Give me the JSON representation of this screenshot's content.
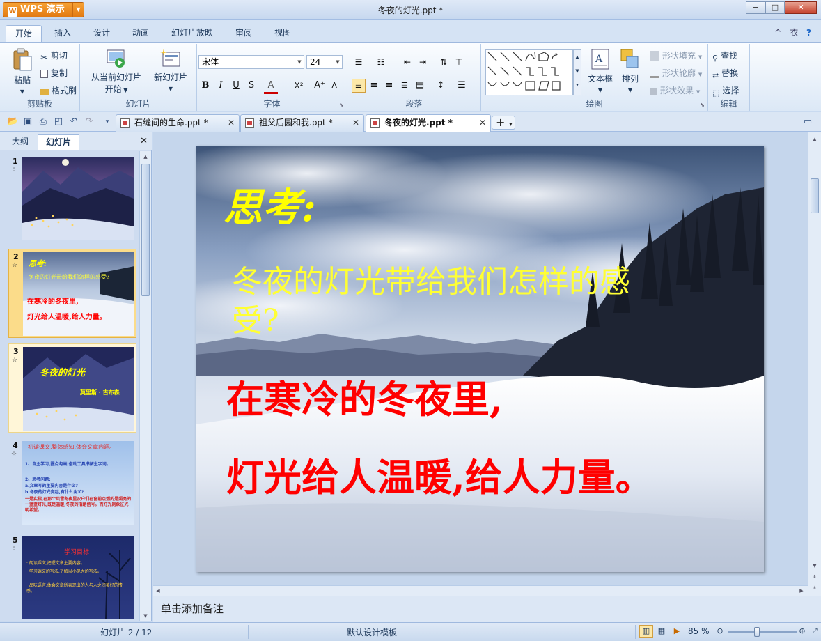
{
  "app": {
    "name": "WPS 演示",
    "logo_letter": "W"
  },
  "window": {
    "title": "冬夜的灯光.ppt *",
    "controls": [
      "−",
      "□",
      "✕"
    ]
  },
  "menu": {
    "tabs": [
      "开始",
      "插入",
      "设计",
      "动画",
      "幻灯片放映",
      "审阅",
      "视图"
    ],
    "active": "开始",
    "right_icons": [
      "^",
      "衣",
      "?"
    ]
  },
  "ribbon": {
    "clipboard": {
      "paste": "粘贴",
      "cut": "剪切",
      "copy": "复制",
      "format_painter": "格式刷",
      "group": "剪贴板"
    },
    "slides": {
      "from_current_line1": "从当前幻灯片",
      "from_current_line2": "开始",
      "new_slide": "新幻灯片",
      "group": "幻灯片"
    },
    "font": {
      "name": "宋体",
      "size": "24",
      "group": "字体",
      "bold": "B",
      "italic": "I",
      "underline": "U",
      "shadow": "S",
      "color": "A",
      "superscript": "X²",
      "grow": "A⁺",
      "shrink": "A⁻"
    },
    "paragraph": {
      "group": "段落"
    },
    "drawing": {
      "textbox": "文本框",
      "arrange": "排列",
      "shape_fill": "形状填充",
      "shape_outline": "形状轮廓",
      "shape_effect": "形状效果",
      "group": "绘图"
    },
    "edit": {
      "find": "查找",
      "replace": "替换",
      "select": "选择",
      "group": "编辑"
    }
  },
  "doc_tabs": [
    {
      "label": "石缝间的生命.ppt *",
      "active": false
    },
    {
      "label": "祖父后园和我.ppt *",
      "active": false
    },
    {
      "label": "冬夜的灯光.ppt *",
      "active": true
    }
  ],
  "left_panel": {
    "tabs": [
      "大纲",
      "幻灯片"
    ],
    "active_tab": "幻灯片",
    "slides": [
      {
        "num": "1",
        "selected": false
      },
      {
        "num": "2",
        "selected": true,
        "title": "思考:",
        "q": "冬夜的灯光带给我们怎样的感受?",
        "a1": "在寒冷的冬夜里,",
        "a2": "灯光给人温暖,给人力量。"
      },
      {
        "num": "3",
        "selected": false,
        "title": "冬夜的灯光",
        "author": "莫里斯 · 古布森"
      },
      {
        "num": "4",
        "selected": false,
        "t1": "初读课文,整体感知,体会文章内涵。",
        "t2": "1、自主学习,圈点勾画,借助工具书解生字词。",
        "t3": "2、思考问题:",
        "t4": "a.文章写的主要内容是什么?",
        "t5": "b.冬夜的灯光亮起,有什么含义?",
        "t6": "一是实指,在那个风雪冬夜里农户们在窗前点燃的是照亮的一盏盏灯光,既是温暖,冬夜的指路信号。而灯光则象征光明希望。"
      },
      {
        "num": "5",
        "selected": false,
        "title": "学习目标",
        "b1": "· 朗读课文,把握文章主要内容。",
        "b2": "· 学习课文的写法,了解以小见大的写法。",
        "b3": "· 品味语言,体会文章所表现出的人与人之间美好的情感。"
      }
    ]
  },
  "slide": {
    "title": "思考:",
    "question_line1": "冬夜的灯光带给我们怎样的感",
    "question_line2": "受?",
    "answer_line1": "在寒冷的冬夜里,",
    "answer_line2": "灯光给人温暖,给人力量。",
    "colors": {
      "title": "#ffff00",
      "question": "#ffff33",
      "answer": "#ff0000"
    }
  },
  "notes_placeholder": "单击添加备注",
  "status": {
    "slide_info": "幻灯片 2 / 12",
    "template": "默认设计模板",
    "zoom": "85 %"
  }
}
